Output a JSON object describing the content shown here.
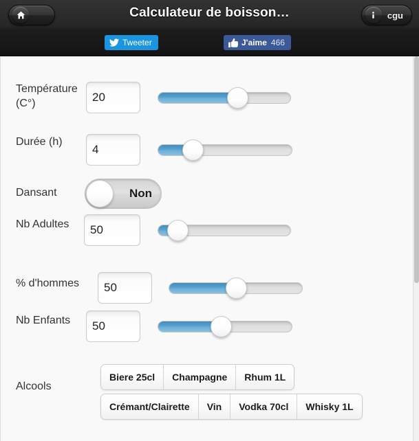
{
  "header": {
    "title": "Calculateur de boisson…",
    "home_button": {
      "name": "home-button",
      "icon": "home-icon",
      "label": ""
    },
    "cgu_button": {
      "icon": "info-icon",
      "label": "cgu"
    }
  },
  "social": {
    "tweet": {
      "icon": "twitter-bird-icon",
      "label": "Tweeter"
    },
    "like": {
      "icon": "thumbs-up-icon",
      "label": "J'aime",
      "count": "466"
    }
  },
  "form": {
    "temperature": {
      "label": "Température (C°)",
      "value": "20",
      "slider": {
        "percent": 60,
        "min": 0,
        "max": 100
      }
    },
    "duree": {
      "label": "Durée (h)",
      "value": "4",
      "slider": {
        "percent": 26,
        "min": 0,
        "max": 100
      }
    },
    "dansant": {
      "label": "Dansant",
      "value": "Non",
      "state": "off"
    },
    "nb_adultes": {
      "label": "Nb Adultes",
      "value": "50",
      "slider": {
        "percent": 15,
        "min": 0,
        "max": 100
      }
    },
    "pct_hommes": {
      "label": "% d'hommes",
      "value": "50",
      "slider": {
        "percent": 50,
        "min": 0,
        "max": 100
      }
    },
    "nb_enfants": {
      "label": "Nb Enfants",
      "value": "50",
      "slider": {
        "percent": 47,
        "min": 0,
        "max": 100
      }
    },
    "alcools": {
      "label": "Alcools",
      "row1": [
        "Biere 25cl",
        "Champagne",
        "Rhum 1L"
      ],
      "row2": [
        "Crémant/Clairette",
        "Vin",
        "Vodka 70cl",
        "Whisky 1L"
      ]
    }
  },
  "colors": {
    "accent_blue": "#5ba2ce",
    "twitter_blue": "#1b95e0",
    "facebook_blue": "#3b5998",
    "header_dark": "#1d1d1d",
    "page_bg": "#f9f9f9"
  }
}
